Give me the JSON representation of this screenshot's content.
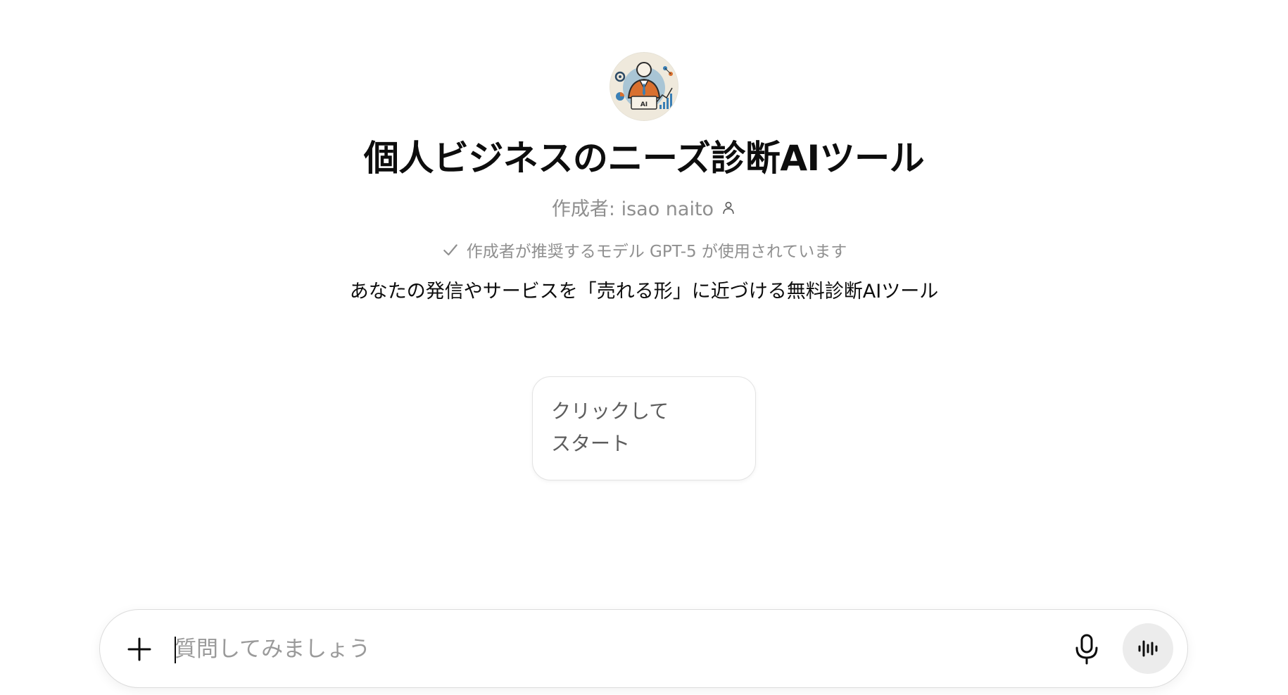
{
  "gpt": {
    "title": "個人ビジネスのニーズ診断AIツール",
    "author": "作成者: isao naito",
    "model_note": "作成者が推奨するモデル GPT-5 が使用されています",
    "description": "あなたの発信やサービスを「売れる形」に近づける無料診断AIツール",
    "avatar_text": "AI"
  },
  "conversation_starters": [
    {
      "label": "クリックしてスタート"
    }
  ],
  "composer": {
    "placeholder": "質問してみましょう",
    "value": ""
  },
  "icons": {
    "author": "person-icon",
    "model_note": "check-icon",
    "add": "plus-icon",
    "mic": "microphone-icon",
    "voice": "voice-mode-icon"
  },
  "colors": {
    "text_primary": "#0d0d0d",
    "text_secondary": "#8f8f8f",
    "voice_button_bg": "#ececec",
    "avatar_accent": "#d9702f",
    "avatar_blue": "#3a7fb5"
  }
}
